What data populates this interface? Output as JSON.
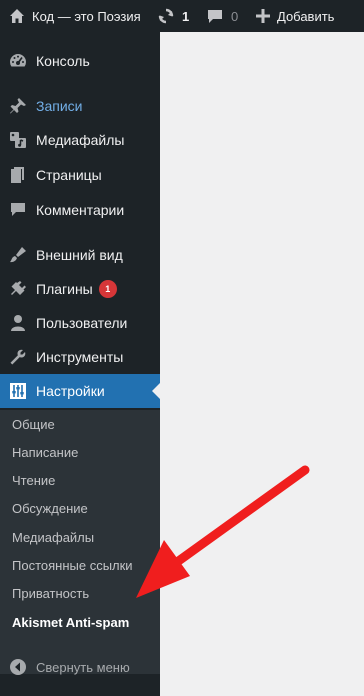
{
  "adminbar": {
    "site_name": "Код — это Поэзия",
    "updates_count": "1",
    "comments_count": "0",
    "add_new_label": "Добавить"
  },
  "menu": {
    "items": [
      {
        "label": "Консоль",
        "icon": "dashboard-icon"
      },
      {
        "label": "Записи",
        "icon": "pin-icon"
      },
      {
        "label": "Медиафайлы",
        "icon": "media-icon"
      },
      {
        "label": "Страницы",
        "icon": "pages-icon"
      },
      {
        "label": "Комментарии",
        "icon": "comment-icon"
      },
      {
        "label": "Внешний вид",
        "icon": "brush-icon"
      },
      {
        "label": "Плагины",
        "icon": "plugin-icon",
        "badge": "1"
      },
      {
        "label": "Пользователи",
        "icon": "user-icon"
      },
      {
        "label": "Инструменты",
        "icon": "wrench-icon"
      },
      {
        "label": "Настройки",
        "icon": "settings-icon"
      }
    ],
    "collapse_label": "Свернуть меню"
  },
  "submenu": {
    "items": [
      {
        "label": "Общие"
      },
      {
        "label": "Написание"
      },
      {
        "label": "Чтение"
      },
      {
        "label": "Обсуждение"
      },
      {
        "label": "Медиафайлы"
      },
      {
        "label": "Постоянные ссылки"
      },
      {
        "label": "Приватность"
      },
      {
        "label": "Akismet Anti-spam"
      }
    ]
  },
  "colors": {
    "admin_bg": "#1d2327",
    "submenu_bg": "#2c3338",
    "current_bg": "#2271b1",
    "link_hover": "#72aee6",
    "badge_bg": "#d63638",
    "annotation_arrow": "#f01e1e",
    "content_bg": "#f0f0f1"
  }
}
